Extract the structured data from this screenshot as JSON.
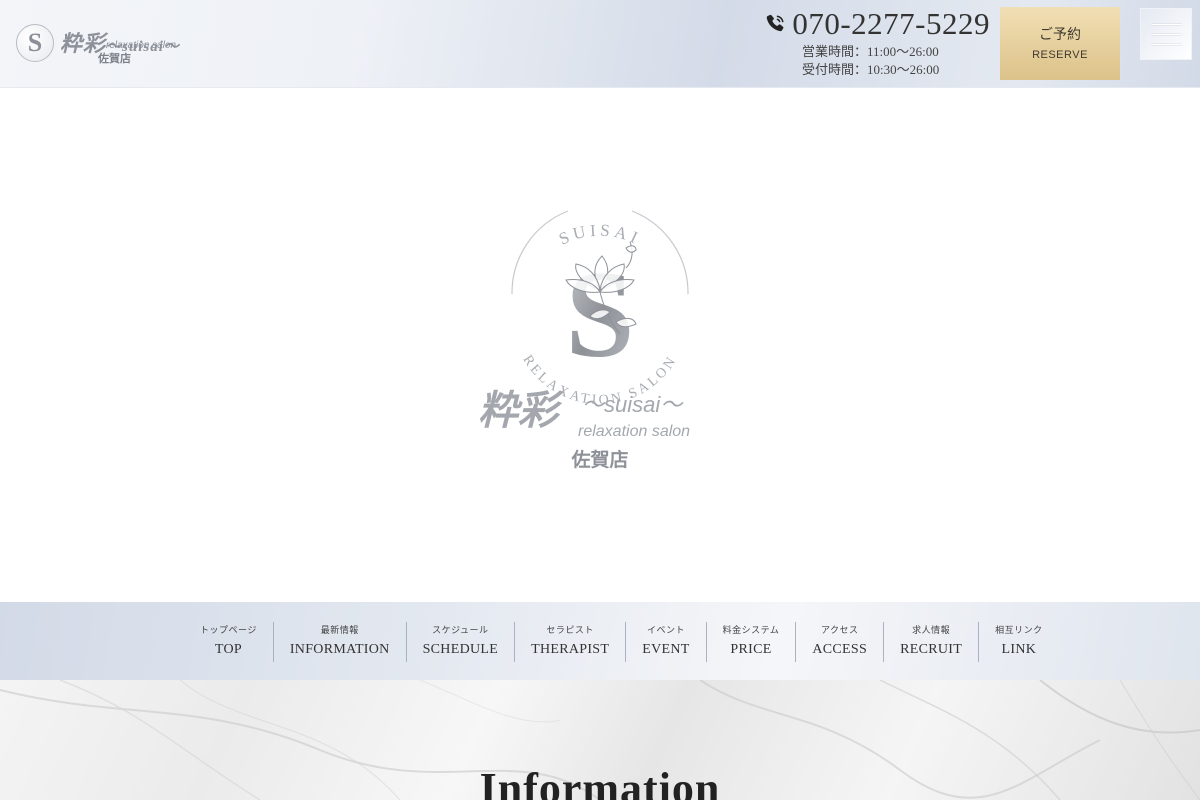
{
  "header": {
    "logo": {
      "emblem_letter": "S",
      "name_kanji": "粋彩",
      "name_roman": "〜suisai〜",
      "subtitle": "relaxation salon",
      "branch": "佐賀店"
    },
    "phone": "070-2277-5229",
    "hours_business": "営業時間：11:00〜26:00",
    "hours_reception": "受付時間：10:30〜26:00",
    "reserve": {
      "label_jp": "ご予約",
      "label_en": "RESERVE"
    },
    "menu_icon": "hamburger-icon",
    "phone_icon": "phone-icon"
  },
  "hero": {
    "logo": {
      "arc_top": "SUISAI",
      "arc_bottom": "RELAXATION SALON",
      "letter": "S",
      "name_kanji": "粋彩",
      "name_roman": "〜suisai〜",
      "subtitle": "relaxation salon",
      "branch": "佐賀店"
    }
  },
  "nav": {
    "items": [
      {
        "jp": "トップページ",
        "en": "TOP"
      },
      {
        "jp": "最新情報",
        "en": "INFORMATION"
      },
      {
        "jp": "スケジュール",
        "en": "SCHEDULE"
      },
      {
        "jp": "セラピスト",
        "en": "THERAPIST"
      },
      {
        "jp": "イベント",
        "en": "EVENT"
      },
      {
        "jp": "料金システム",
        "en": "PRICE"
      },
      {
        "jp": "アクセス",
        "en": "ACCESS"
      },
      {
        "jp": "求人情報",
        "en": "RECRUIT"
      },
      {
        "jp": "相互リンク",
        "en": "LINK"
      }
    ]
  },
  "information": {
    "title": "Information"
  },
  "colors": {
    "reserve_gold": "#dcc28a",
    "header_blue": "#d4dbe8",
    "logo_silver": "#8d9199"
  }
}
